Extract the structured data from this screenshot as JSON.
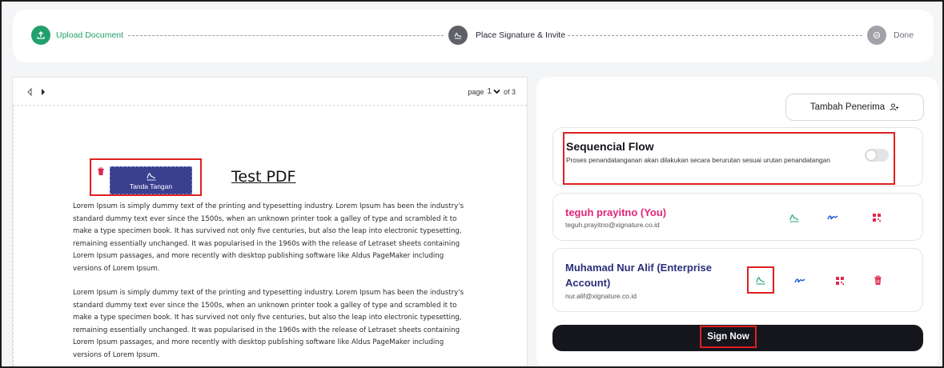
{
  "stepper": {
    "steps": [
      {
        "label": "Upload Document",
        "state": "active",
        "color": "#22a06b",
        "icon": "upload-icon"
      },
      {
        "label": "Place Signature & Invite",
        "state": "current",
        "color": "#5f6068",
        "icon": "signature-icon"
      },
      {
        "label": "Done",
        "state": "pending",
        "color": "#a0a2a8",
        "icon": "check-icon"
      }
    ]
  },
  "viewer": {
    "page_label": "page",
    "page_current": "1",
    "page_total": "of 3",
    "doc_title": "Test PDF",
    "paragraphs": [
      "Lorem Ipsum is simply dummy text of the printing and typesetting industry. Lorem Ipsum has been the industry's standard dummy text ever since the 1500s, when an unknown printer took a galley of type and scrambled it to make a type specimen book. It has survived not only five centuries, but also the leap into electronic typesetting, remaining essentially unchanged. It was popularised in the 1960s with the release of Letraset sheets containing Lorem Ipsum passages, and more recently with desktop publishing software like Aldus PageMaker including versions of Lorem Ipsum.",
      "Lorem Ipsum is simply dummy text of the printing and typesetting industry. Lorem Ipsum has been the industry's standard dummy text ever since the 1500s, when an unknown printer took a galley of type and scrambled it to make a type specimen book. It has survived not only five centuries, but also the leap into electronic typesetting, remaining essentially unchanged. It was popularised in the 1960s with the release of Letraset sheets containing Lorem Ipsum passages, and more recently with desktop publishing software like Aldus PageMaker including versions of Lorem Ipsum."
    ],
    "signature_field_label": "Tanda Tangan"
  },
  "panel": {
    "add_recipient_label": "Tambah Penerima",
    "flow": {
      "title": "Sequencial Flow",
      "description": "Proses penandatanganan akan dilakukan secara berurutan sesuai urutan penandatangan",
      "enabled": false
    },
    "signers": [
      {
        "name": "teguh prayitno (You)",
        "email": "teguh.prayitno@xignature.co.id",
        "name_color": "#e0267a"
      },
      {
        "name": "Muhamad Nur Alif (Enterprise Account)",
        "email": "nur.alif@xignature.co.id",
        "name_color": "#2b2f7a"
      }
    ],
    "sign_now_label": "Sign Now"
  },
  "colors": {
    "accent_green": "#22a06b",
    "accent_blue": "#2356d9",
    "accent_red": "#e0264f",
    "highlight": "#e02020"
  }
}
